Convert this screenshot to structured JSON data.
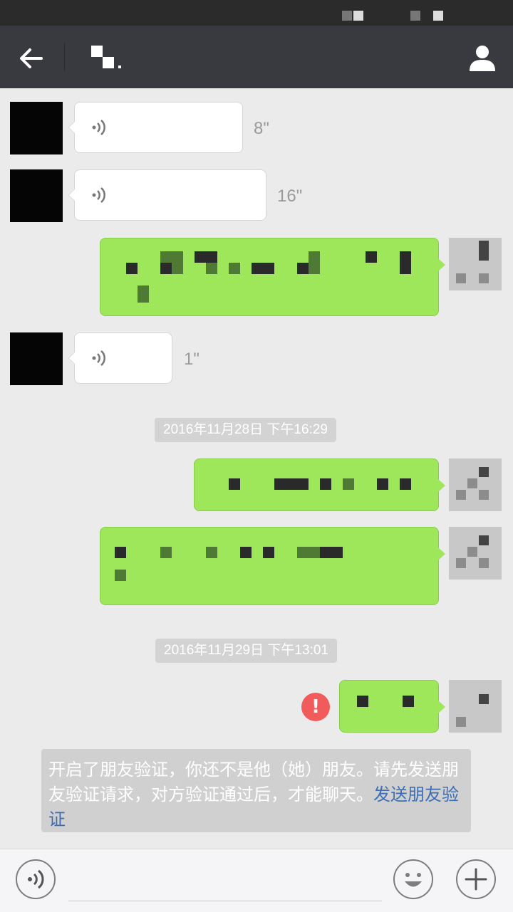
{
  "status_bar": {},
  "nav": {
    "back_icon": "arrow-left-icon",
    "title": "",
    "profile_icon": "person-icon"
  },
  "messages": [
    {
      "type": "voice",
      "side": "left",
      "duration": "8\""
    },
    {
      "type": "voice",
      "side": "left",
      "duration": "16\""
    },
    {
      "type": "text",
      "side": "right",
      "text": ""
    },
    {
      "type": "voice",
      "side": "left",
      "duration": "1\""
    },
    {
      "type": "timestamp",
      "text": "2016年11月28日 下午16:29"
    },
    {
      "type": "text",
      "side": "right",
      "text": ""
    },
    {
      "type": "text",
      "side": "right",
      "text": ""
    },
    {
      "type": "timestamp",
      "text": "2016年11月29日 下午13:01"
    },
    {
      "type": "text",
      "side": "right",
      "text": "",
      "status": "failed"
    }
  ],
  "system_notice": {
    "text": "开启了朋友验证，你还不是他（她）朋友。请先发送朋友验证请求，对方验证通过后，才能聊天。",
    "link": "发送朋友验证"
  },
  "input_bar": {
    "voice_icon": "voice-icon",
    "emoji_icon": "emoji-icon",
    "plus_icon": "plus-icon"
  },
  "colors": {
    "nav_bg": "#393a3f",
    "chat_bg": "#ebebeb",
    "sent_bubble": "#9ee75b",
    "error": "#f25b5b",
    "link": "#3d6db5"
  }
}
